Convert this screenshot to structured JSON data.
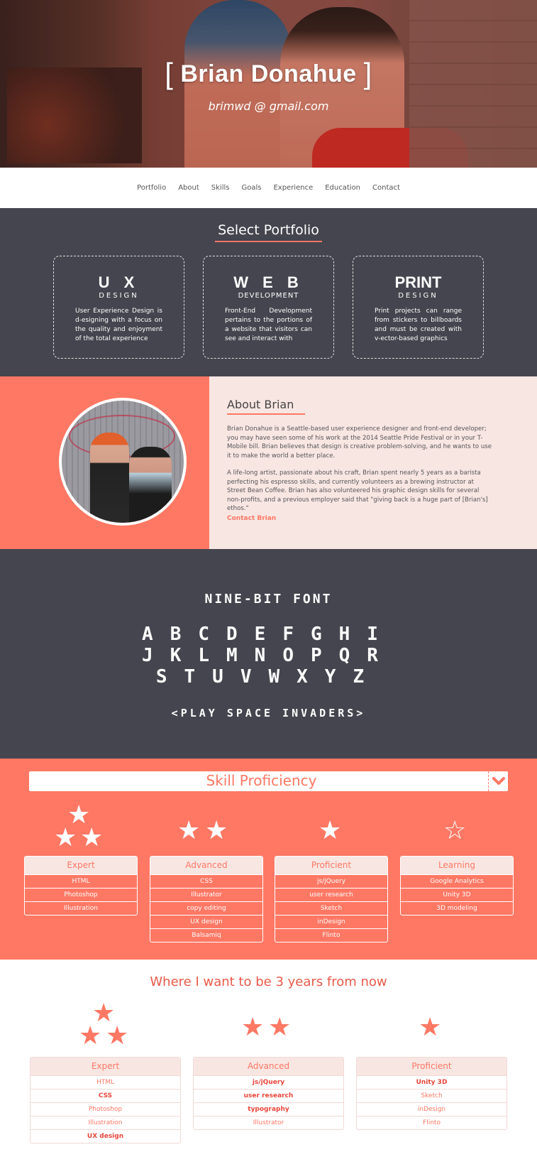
{
  "hero": {
    "bracket_left": "[",
    "name": "Brian Donahue",
    "bracket_right": "]",
    "email": "brimwd @ gmail.com"
  },
  "nav": [
    "Portfolio",
    "About",
    "Skills",
    "Goals",
    "Experience",
    "Education",
    "Contact"
  ],
  "portfolio": {
    "title": "Select Portfolio",
    "cards": [
      {
        "big": "U X",
        "small": "DESIGN",
        "desc": "User Experience Design is d-esigning with a focus on the quality and enjoyment of the total experience"
      },
      {
        "big": "W E B",
        "small": "DEVELOPMENT",
        "desc": "Front-End Development pertains to the portions of a website that visitors can see and interact with"
      },
      {
        "big": "PRINT",
        "small": "DESIGN",
        "desc": "Print projects can range from stickers to billboards and must be created with v-ector-based graphics"
      }
    ]
  },
  "about": {
    "title": "About Brian",
    "p1": "Brian Donahue is a Seattle-based user experience designer and front-end developer; you may have seen some of his work at the 2014 Seattle Pride Festival or in your T-Mobile bill. Brian believes that design is creative problem-solving, and he wants to use it to make the world a better place.",
    "p2": "A life-long artist, passionate about his craft, Brian spent nearly 5 years as a barista perfecting his espresso skills, and currently volunteers as a brewing instructor at Street Bean Coffee. Brian has also volunteered his graphic design skills for several non-profits, and a previous employer said that \"giving back is a huge part of [Brian's] ethos.\"",
    "contact": "Contact Brian"
  },
  "ninebit": {
    "title": "NINE-BIT FONT",
    "row1": "ABCDEFGHI",
    "row2": "JKLMNOPQR",
    "row3": "STUVWXYZ",
    "invaders": "<PLAY SPACE INVADERS>"
  },
  "skills": {
    "title": "Skill Proficiency",
    "star_glyph": "★",
    "star_outline": "☆",
    "cols": [
      {
        "name": "Expert",
        "items": [
          "HTML",
          "Photoshop",
          "Illustration"
        ]
      },
      {
        "name": "Advanced",
        "items": [
          "CSS",
          "Illustrator",
          "copy editing",
          "UX design",
          "Balsamiq"
        ]
      },
      {
        "name": "Proficient",
        "items": [
          "js/jQuery",
          "user research",
          "Sketch",
          "inDesign",
          "Flinto"
        ]
      },
      {
        "name": "Learning",
        "items": [
          "Google Analytics",
          "Unity 3D",
          "3D modeling"
        ]
      }
    ]
  },
  "goals": {
    "title": "Where I want to be 3 years from now",
    "cols": [
      {
        "name": "Expert",
        "items": [
          {
            "t": "HTML",
            "b": false
          },
          {
            "t": "CSS",
            "b": true
          },
          {
            "t": "Photoshop",
            "b": false
          },
          {
            "t": "Illustration",
            "b": false
          },
          {
            "t": "UX design",
            "b": true
          }
        ]
      },
      {
        "name": "Advanced",
        "items": [
          {
            "t": "js/jQuery",
            "b": true
          },
          {
            "t": "user research",
            "b": true
          },
          {
            "t": "typography",
            "b": true
          },
          {
            "t": "Illustrator",
            "b": false
          }
        ]
      },
      {
        "name": "Proficient",
        "items": [
          {
            "t": "Unity 3D",
            "b": true
          },
          {
            "t": "Sketch",
            "b": false
          },
          {
            "t": "inDesign",
            "b": false
          },
          {
            "t": "Flinto",
            "b": false
          }
        ]
      }
    ]
  },
  "colors": {
    "accent": "#ff7864",
    "dark": "#45454f",
    "pale": "#f8e6e3"
  }
}
